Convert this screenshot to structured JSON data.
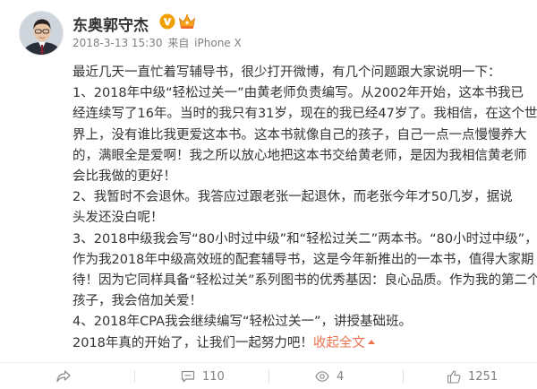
{
  "post": {
    "author": "东奥郭守杰",
    "timestamp": "2018-3-13 15:30",
    "source_prefix": "来自",
    "source": "iPhone X",
    "paragraphs": [
      [
        "最近几天一直忙着写辅导书，很少打开微博，有几个问题跟大家说明一下："
      ],
      [
        "   1、2018年中级“轻松过关一”由黄老师负责编写。从2002年开始，这本书我已",
        "经连续写了16年。当时的我只有31岁，现在的我已经47岁了。我相信，在这个世",
        "界上，没有谁比我更爱这本书。这本书就像自己的孩子，自己一点一点慢慢养大",
        "的，满眼全是爱啊！我之所以放心地把这本书交给黄老师，是因为我相信黄老师",
        "会比我做的更好！"
      ],
      [
        "   2、我暂时不会退休。我答应过跟老张一起退休，而老张今年才50几岁，据说",
        "头发还没白呢！"
      ],
      [
        "   3、2018中级我会写“80小时过中级”和“轻松过关二”两本书。“80小时过中级”，",
        "作为我2018年中级高效班的配套辅导书，这是今年新推出的一本书，值得大家期",
        "待！因为它同样具备“轻松过关”系列图书的优秀基因：良心品质。作为我的第二个",
        "孩子，我会倍加关爱！"
      ],
      [
        "   4、2018年CPA我会继续编写“轻松过关一”，讲授基础班。"
      ]
    ],
    "closing": "   2018年真的开始了，让我们一起努力吧！",
    "collapse_label": "收起全文"
  },
  "actions": {
    "forward_label": "",
    "comment_count": "110",
    "like_count": "1251",
    "view_count": "4"
  },
  "icons": {
    "verified": "verified-v-badge-icon",
    "member": "vip-crown-icon",
    "forward": "forward-icon",
    "comment": "comment-icon",
    "like": "like-thumb-icon"
  },
  "colors": {
    "accent": "#eb7350",
    "text": "#333333",
    "meta": "#808080",
    "verified": "#f2a000"
  }
}
